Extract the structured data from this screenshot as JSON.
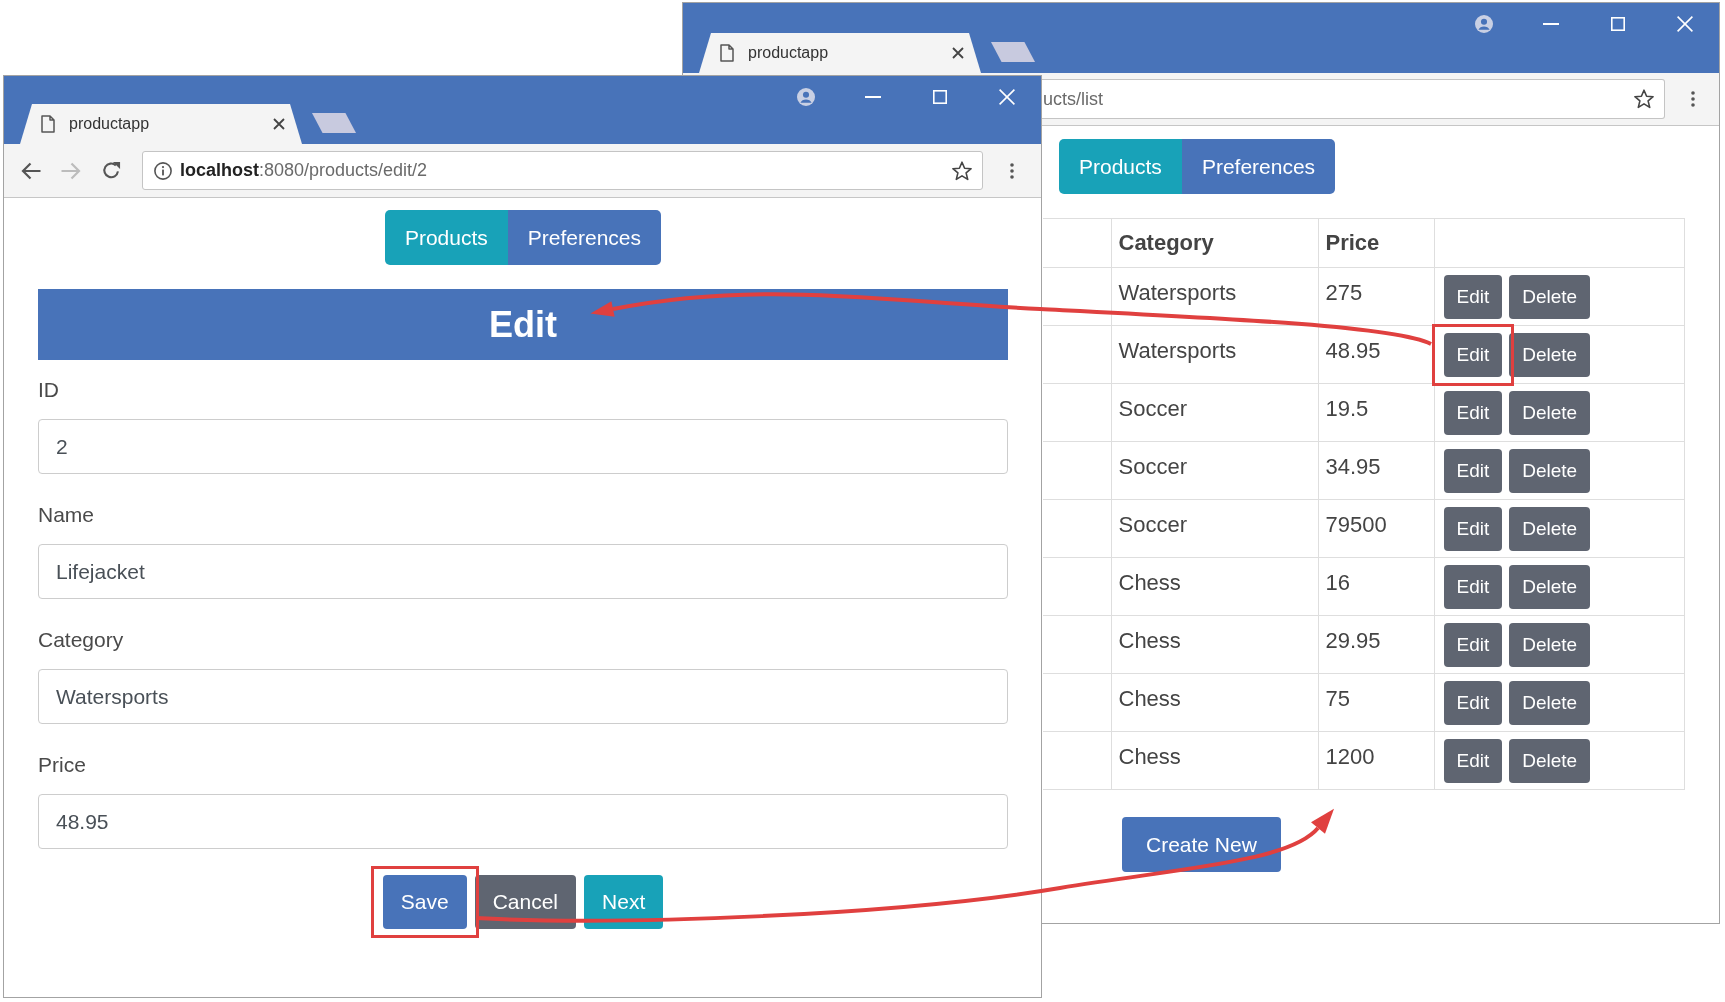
{
  "list_window": {
    "tab": {
      "title": "productapp"
    },
    "address": "ucts/list",
    "nav": [
      {
        "label": "Products",
        "selected": true
      },
      {
        "label": "Preferences",
        "selected": false
      }
    ],
    "table": {
      "columns": [
        "Category",
        "Price"
      ],
      "rows": [
        {
          "category": "Watersports",
          "price": "275",
          "buttons": [
            {
              "label": "Edit",
              "highlighted": false
            },
            {
              "label": "Delete",
              "highlighted": false
            }
          ]
        },
        {
          "category": "Watersports",
          "price": "48.95",
          "buttons": [
            {
              "label": "Edit",
              "highlighted": true
            },
            {
              "label": "Delete",
              "highlighted": false
            }
          ]
        },
        {
          "category": "Soccer",
          "price": "19.5",
          "buttons": [
            {
              "label": "Edit",
              "highlighted": false
            },
            {
              "label": "Delete",
              "highlighted": false
            }
          ]
        },
        {
          "category": "Soccer",
          "price": "34.95",
          "buttons": [
            {
              "label": "Edit",
              "highlighted": false
            },
            {
              "label": "Delete",
              "highlighted": false
            }
          ]
        },
        {
          "category": "Soccer",
          "price": "79500",
          "buttons": [
            {
              "label": "Edit",
              "highlighted": false
            },
            {
              "label": "Delete",
              "highlighted": false
            }
          ]
        },
        {
          "category": "Chess",
          "price": "16",
          "buttons": [
            {
              "label": "Edit",
              "highlighted": false
            },
            {
              "label": "Delete",
              "highlighted": false
            }
          ]
        },
        {
          "category": "Chess",
          "price": "29.95",
          "buttons": [
            {
              "label": "Edit",
              "highlighted": false
            },
            {
              "label": "Delete",
              "highlighted": false
            }
          ]
        },
        {
          "category": "Chess",
          "price": "75",
          "buttons": [
            {
              "label": "Edit",
              "highlighted": false
            },
            {
              "label": "Delete",
              "highlighted": false
            }
          ]
        },
        {
          "category": "Chess",
          "price": "1200",
          "buttons": [
            {
              "label": "Edit",
              "highlighted": false
            },
            {
              "label": "Delete",
              "highlighted": false
            }
          ]
        }
      ]
    },
    "create_button": {
      "label": "Create New"
    }
  },
  "edit_window": {
    "tab": {
      "title": "productapp"
    },
    "toolbar": [
      {
        "kind": "back",
        "disabled": false
      },
      {
        "kind": "forward",
        "disabled": true
      },
      {
        "kind": "reload",
        "disabled": false
      }
    ],
    "address": "**localhost**:8080/products/edit/2",
    "nav": [
      {
        "label": "Products",
        "selected": true
      },
      {
        "label": "Preferences",
        "selected": false
      }
    ],
    "heading": "Edit",
    "fields": [
      {
        "label": "ID",
        "value": "2"
      },
      {
        "label": "Name",
        "value": "Lifejacket"
      },
      {
        "label": "Category",
        "value": "Watersports"
      },
      {
        "label": "Price",
        "value": "48.95"
      }
    ],
    "buttons": [
      {
        "label": "Save",
        "kind": "primary",
        "highlighted": true
      },
      {
        "label": "Cancel",
        "kind": "secondary",
        "highlighted": false
      },
      {
        "label": "Next",
        "kind": "info",
        "highlighted": false
      }
    ]
  }
}
